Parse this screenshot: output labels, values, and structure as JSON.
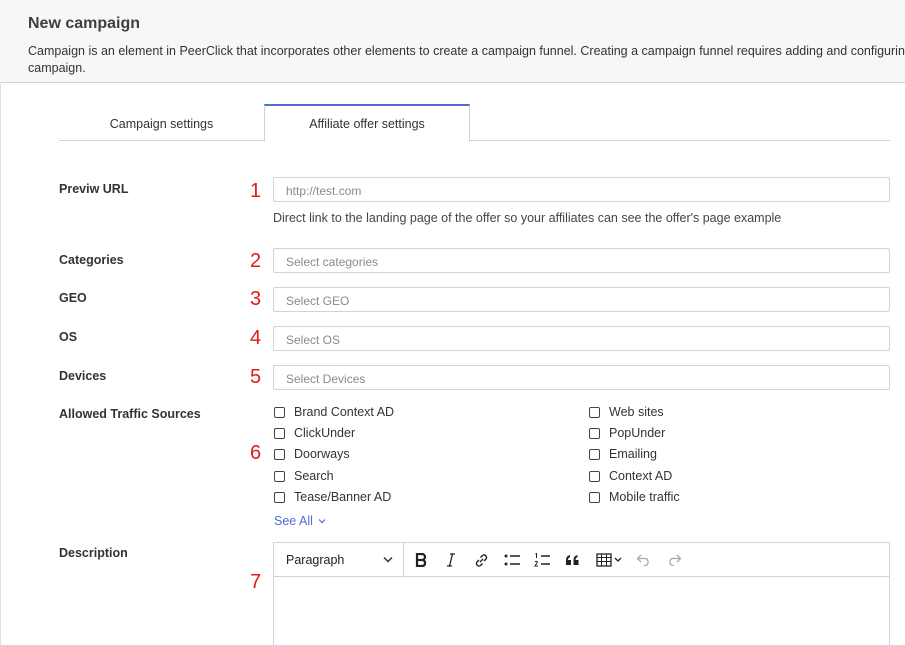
{
  "header": {
    "title": "New campaign",
    "description": "Campaign is an element in PeerClick that incorporates other elements to create a campaign funnel. Creating a campaign funnel requires adding and configuring campaign."
  },
  "tabs": [
    {
      "label": "Campaign settings",
      "active": false
    },
    {
      "label": "Affiliate offer settings",
      "active": true
    }
  ],
  "markers": [
    "1",
    "2",
    "3",
    "4",
    "5",
    "6",
    "7"
  ],
  "form": {
    "preview_url": {
      "label": "Previw URL",
      "placeholder": "http://test.com",
      "hint": "Direct link to the landing page of the offer so your affiliates can see the offer's page example"
    },
    "categories": {
      "label": "Categories",
      "placeholder": "Select categories"
    },
    "geo": {
      "label": "GEO",
      "placeholder": "Select GEO"
    },
    "os": {
      "label": "OS",
      "placeholder": "Select OS"
    },
    "devices": {
      "label": "Devices",
      "placeholder": "Select Devices"
    },
    "traffic": {
      "label": "Allowed Traffic Sources",
      "left": [
        "Brand Context AD",
        "ClickUnder",
        "Doorways",
        "Search",
        "Tease/Banner AD"
      ],
      "right": [
        "Web sites",
        "PopUnder",
        "Emailing",
        "Context AD",
        "Mobile traffic"
      ],
      "see_all": "See All"
    },
    "description": {
      "label": "Description",
      "format": "Paragraph"
    }
  },
  "colors": {
    "accent": "#4e6bd6",
    "marker": "#e01b1b",
    "border": "#cfd3da"
  }
}
